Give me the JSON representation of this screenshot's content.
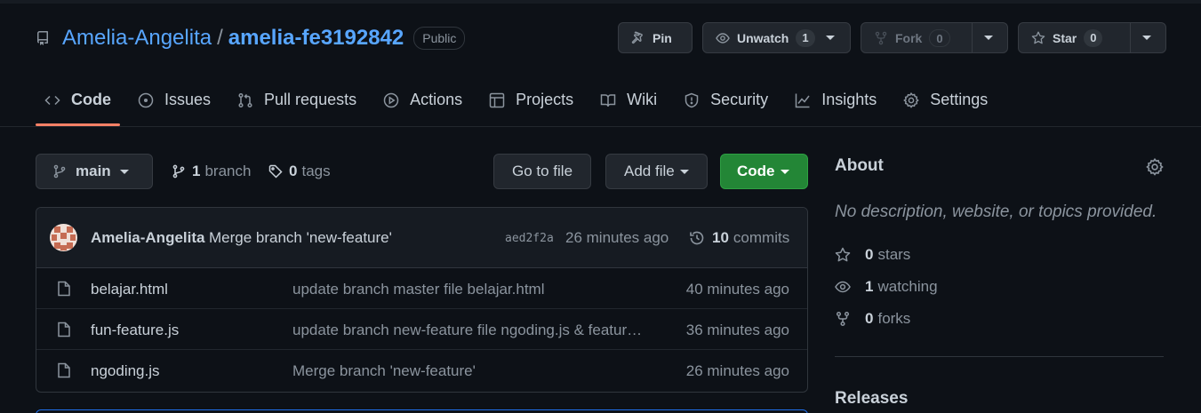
{
  "repo": {
    "owner": "Amelia-Angelita",
    "separator": "/",
    "name": "amelia-fe3192842",
    "visibility": "Public"
  },
  "actions": {
    "pin": "Pin",
    "unwatch": "Unwatch",
    "watch_count": "1",
    "fork": "Fork",
    "fork_count": "0",
    "star": "Star",
    "star_count": "0"
  },
  "nav": {
    "code": "Code",
    "issues": "Issues",
    "pulls": "Pull requests",
    "actions": "Actions",
    "projects": "Projects",
    "wiki": "Wiki",
    "security": "Security",
    "insights": "Insights",
    "settings": "Settings"
  },
  "branch_bar": {
    "branch": "main",
    "branch_count": "1",
    "branch_label": "branch",
    "tag_count": "0",
    "tag_label": "tags",
    "go_to_file": "Go to file",
    "add_file": "Add file",
    "code": "Code"
  },
  "latest_commit": {
    "author": "Amelia-Angelita",
    "message": "Merge branch 'new-feature'",
    "sha": "aed2f2a",
    "time": "26 minutes ago",
    "commit_count": "10",
    "commit_label": "commits"
  },
  "files": [
    {
      "name": "belajar.html",
      "commit": "update branch master file belajar.html",
      "time": "40 minutes ago"
    },
    {
      "name": "fun-feature.js",
      "commit": "update branch new-feature file ngoding.js & featur…",
      "time": "36 minutes ago"
    },
    {
      "name": "ngoding.js",
      "commit": "Merge branch 'new-feature'",
      "time": "26 minutes ago"
    }
  ],
  "about": {
    "title": "About",
    "description": "No description, website, or topics provided.",
    "stars_count": "0",
    "stars_label": "stars",
    "watching_count": "1",
    "watching_label": "watching",
    "forks_count": "0",
    "forks_label": "forks",
    "releases_title": "Releases"
  },
  "colors": {
    "background": "#0d1117",
    "link": "#58a6ff",
    "primary_button": "#238636",
    "active_tab_underline": "#f78166"
  },
  "icons": [
    "repo-icon",
    "pin-icon",
    "eye-icon",
    "fork-icon",
    "star-icon",
    "code-icon",
    "issue-icon",
    "pull-request-icon",
    "play-icon",
    "table-icon",
    "book-icon",
    "shield-icon",
    "graph-icon",
    "gear-icon",
    "branch-icon",
    "tag-icon",
    "history-icon",
    "file-icon"
  ]
}
